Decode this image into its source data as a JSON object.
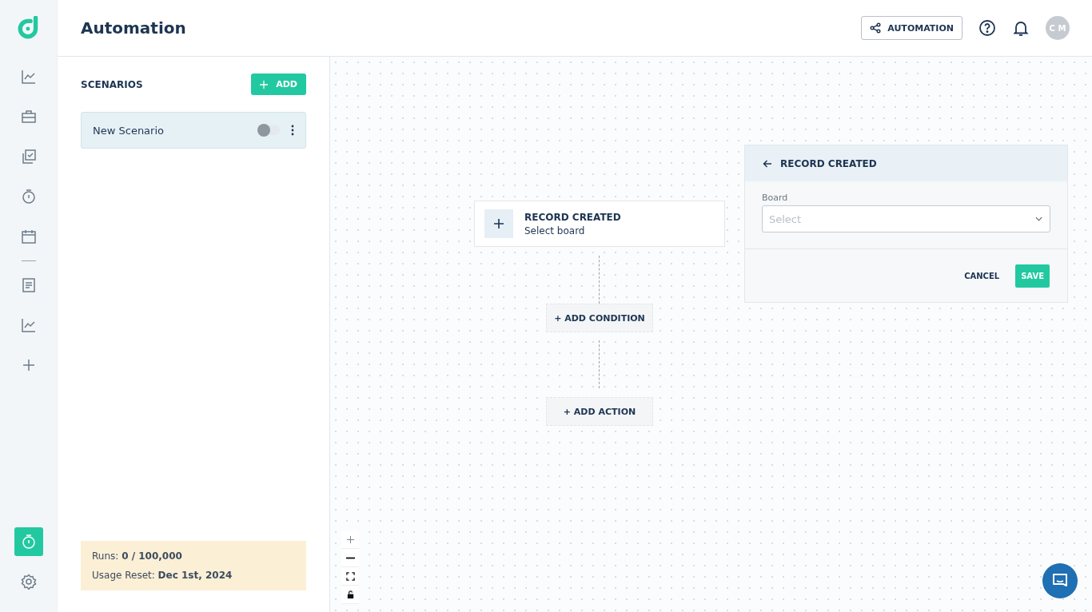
{
  "header": {
    "title": "Automation",
    "automation_button": "AUTOMATION",
    "avatar": "C M"
  },
  "sidebar": {
    "items": [
      {
        "kind": "chart",
        "selected": false
      },
      {
        "kind": "briefcase",
        "selected": false
      },
      {
        "kind": "tasks",
        "selected": false
      },
      {
        "kind": "timer",
        "selected": false
      },
      {
        "kind": "calendar",
        "selected": false
      },
      {
        "kind": "divider"
      },
      {
        "kind": "document",
        "selected": false
      },
      {
        "kind": "chart",
        "selected": false
      },
      {
        "kind": "plus",
        "selected": false
      }
    ],
    "bottom_items": [
      {
        "kind": "timer",
        "selected": true
      },
      {
        "kind": "gear",
        "selected": false
      }
    ]
  },
  "scenarios": {
    "title": "SCENARIOS",
    "add_button": "ADD",
    "items": [
      {
        "name": "New Scenario",
        "on": false,
        "selected": true
      }
    ]
  },
  "usage": {
    "runs": "Runs: **0 / 100,000**",
    "reset": "Usage Reset: **Dec 1st, 2024**"
  },
  "flow": {
    "trigger": {
      "title": "RECORD CREATED",
      "subtitle": "Select board"
    },
    "add_condition": "+ ADD CONDITION",
    "add_action": "+ ADD ACTION"
  },
  "panel": {
    "title": "RECORD CREATED",
    "field_label": "Board",
    "placeholder": "Select",
    "cancel": "CANCEL",
    "save": "SAVE"
  }
}
